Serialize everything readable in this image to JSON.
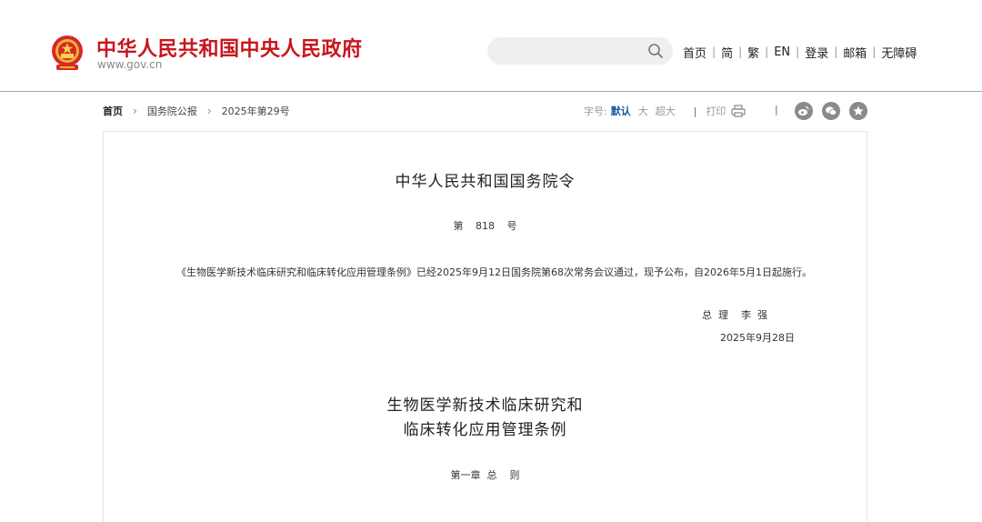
{
  "header": {
    "site_title": "中华人民共和国中央人民政府",
    "site_url": "www.gov.cn",
    "search_placeholder": "",
    "nav": [
      "首页",
      "简",
      "繁",
      "EN",
      "登录",
      "邮箱",
      "无障碍"
    ],
    "brand_color": "#c8161d"
  },
  "breadcrumb": {
    "home": "首页",
    "section": "国务院公报",
    "issue": "2025年第29号"
  },
  "tools": {
    "font_label": "字号:",
    "font_default": "默认",
    "font_large": "大",
    "font_xlarge": "超大",
    "print": "打印",
    "share_icons": [
      "weibo-icon",
      "wechat-icon",
      "favorite-icon"
    ]
  },
  "article": {
    "order_title": "中华人民共和国国务院令",
    "order_number": "第 818 号",
    "body": "《生物医学新技术临床研究和临床转化应用管理条例》已经2025年9月12日国务院第68次常务会议通过，现予公布，自2026年5月1日起施行。",
    "signer": "总  理    李  强",
    "sign_date": "2025年9月28日",
    "regulation_title_line1": "生物医学新技术临床研究和",
    "regulation_title_line2": "临床转化应用管理条例",
    "chapter": "第一章  总    则"
  }
}
